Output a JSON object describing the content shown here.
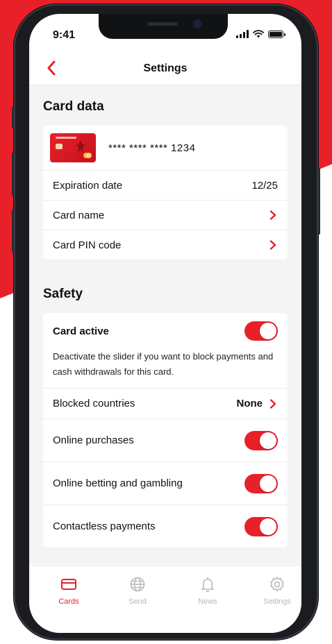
{
  "status_bar": {
    "time": "9:41"
  },
  "header": {
    "title": "Settings"
  },
  "card_data": {
    "section_title": "Card data",
    "card_number": "**** **** **** 1234",
    "expiration_label": "Expiration date",
    "expiration_value": "12/25",
    "card_name_label": "Card name",
    "pin_label": "Card PIN code"
  },
  "safety": {
    "section_title": "Safety",
    "card_active_label": "Card active",
    "card_active_description": "Deactivate the slider if you want to block payments and cash withdrawals for this card.",
    "blocked_countries_label": "Blocked countries",
    "blocked_countries_value": "None",
    "online_purchases_label": "Online purchases",
    "online_betting_label": "Online betting and gambling",
    "contactless_label": "Contactless payments",
    "toggles": {
      "card_active": true,
      "online_purchases": true,
      "online_betting": true,
      "contactless": true
    }
  },
  "tabs": [
    {
      "label": "Cards",
      "icon": "card-icon",
      "active": true
    },
    {
      "label": "Send",
      "icon": "globe-icon",
      "active": false
    },
    {
      "label": "News",
      "icon": "bell-icon",
      "active": false
    },
    {
      "label": "Settings",
      "icon": "gear-icon",
      "active": false
    }
  ],
  "colors": {
    "accent": "#e8202a",
    "inactive": "#b8b8b8",
    "background": "#f4f4f4"
  }
}
